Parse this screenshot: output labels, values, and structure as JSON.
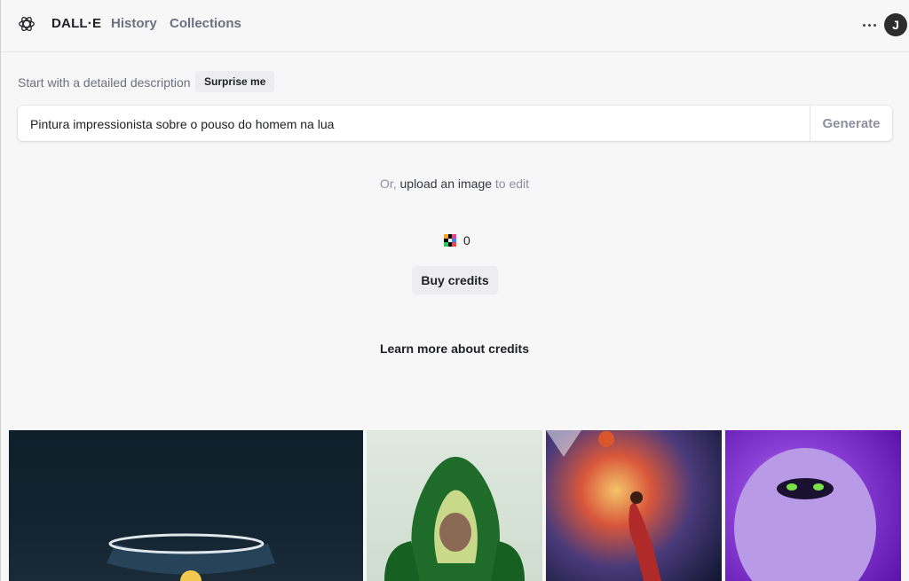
{
  "header": {
    "brand": "DALL·E",
    "nav": [
      {
        "label": "History"
      },
      {
        "label": "Collections"
      }
    ],
    "avatar_initial": "J"
  },
  "prompt": {
    "hint": "Start with a detailed description",
    "surprise_label": "Surprise me",
    "value": "Pintura impressionista sobre o pouso do homem na lua",
    "generate_label": "Generate"
  },
  "upload": {
    "prefix": "Or, ",
    "link": "upload an image",
    "suffix": " to edit"
  },
  "credits": {
    "count": "0",
    "buy_label": "Buy credits",
    "learn_more": "Learn more about credits"
  },
  "gallery": [
    {
      "subject": "fishbowl-image"
    },
    {
      "subject": "avocado-chair-image"
    },
    {
      "subject": "cosmic-basketball-image"
    },
    {
      "subject": "purple-monster-image"
    }
  ],
  "colors": {
    "accent": "#202123",
    "muted": "#6e6e80",
    "surface": "#f7f7f8",
    "button": "#ececf1"
  }
}
